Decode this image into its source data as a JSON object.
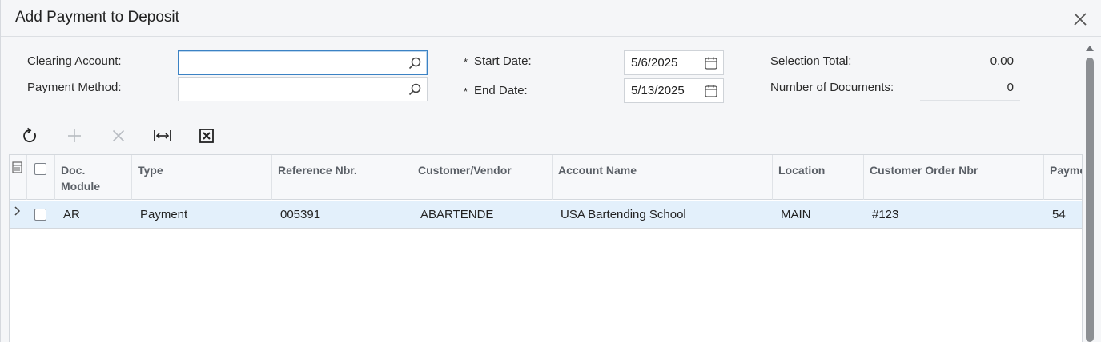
{
  "dialog": {
    "title": "Add Payment to Deposit"
  },
  "form": {
    "clearing_account": {
      "label": "Clearing Account:",
      "value": "",
      "placeholder": ""
    },
    "payment_method": {
      "label": "Payment Method:",
      "value": "",
      "placeholder": ""
    },
    "start_date": {
      "required": "*",
      "label": "Start Date:",
      "value": "5/6/2025"
    },
    "end_date": {
      "required": "*",
      "label": "End Date:",
      "value": "5/13/2025"
    },
    "selection_total": {
      "label": "Selection Total:",
      "value": "0.00"
    },
    "number_of_documents": {
      "label": "Number of Documents:",
      "value": "0"
    }
  },
  "toolbar": {
    "icons": [
      "refresh-icon",
      "add-icon",
      "delete-icon",
      "fit-columns-icon",
      "export-excel-icon"
    ]
  },
  "grid": {
    "columns": [
      {
        "key": "doc_module",
        "label_line1": "Doc.",
        "label_line2": "Module"
      },
      {
        "key": "type",
        "label_line1": "Type",
        "label_line2": ""
      },
      {
        "key": "reference_nbr",
        "label_line1": "Reference Nbr.",
        "label_line2": ""
      },
      {
        "key": "customer_vendor",
        "label_line1": "Customer/Vendor",
        "label_line2": ""
      },
      {
        "key": "account_name",
        "label_line1": "Account Name",
        "label_line2": ""
      },
      {
        "key": "location",
        "label_line1": "Location",
        "label_line2": ""
      },
      {
        "key": "customer_order_nbr",
        "label_line1": "Customer Order Nbr",
        "label_line2": ""
      },
      {
        "key": "payment",
        "label_line1": "Payme",
        "label_line2": ""
      }
    ],
    "rows": [
      {
        "doc_module": "AR",
        "type": "Payment",
        "reference_nbr": "005391",
        "customer_vendor": "ABARTENDE",
        "account_name": "USA Bartending School",
        "location": "MAIN",
        "customer_order_nbr": "#123",
        "payment": "54"
      }
    ]
  },
  "colors": {
    "accent": "#3b82c4",
    "selected_row": "#e3f0fb",
    "background": "#f5f6f8"
  }
}
